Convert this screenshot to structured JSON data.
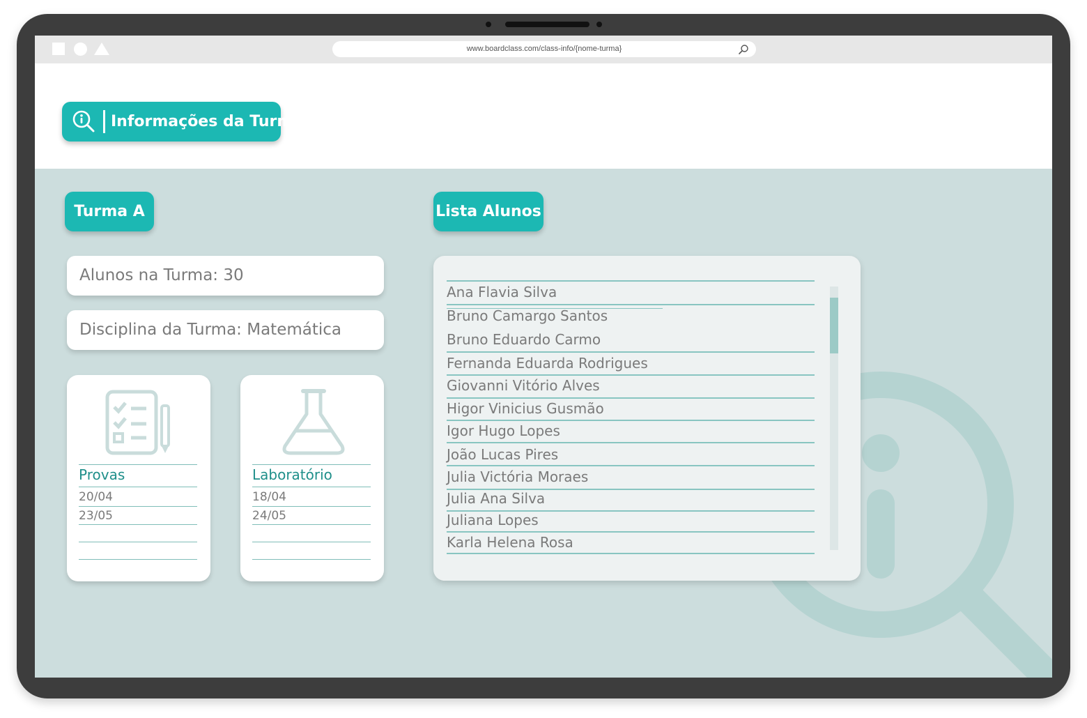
{
  "browser": {
    "url": "www.boardclass.com/class-info/{nome-turma}"
  },
  "header": {
    "title": "Informações da Turma"
  },
  "class": {
    "name": "Turma A",
    "students_count_label": "Alunos na Turma: 30",
    "subject_label": "Disciplina da Turma: Matemática"
  },
  "cards": {
    "provas": {
      "title": "Provas",
      "dates": [
        "20/04",
        "23/05"
      ],
      "icon": "test-clipboard-icon"
    },
    "laboratorio": {
      "title": "Laboratório",
      "dates": [
        "18/04",
        "24/05"
      ],
      "icon": "flask-icon"
    }
  },
  "students": {
    "title": "Lista Alunos",
    "items": [
      "Ana Flavia Silva",
      "Bruno Camargo Santos",
      "Bruno Eduardo Carmo",
      "Fernanda Eduarda Rodrigues",
      "Giovanni Vitório Alves",
      "Higor Vinicius Gusmão",
      "Igor Hugo Lopes",
      "João Lucas Pires",
      "Julia Victória Moraes",
      "Julia Ana Silva",
      "Juliana Lopes",
      "Karla Helena Rosa"
    ]
  },
  "colors": {
    "accent": "#1cb8b3",
    "content_bg": "#ccdddd",
    "device": "#3d3d3d"
  }
}
